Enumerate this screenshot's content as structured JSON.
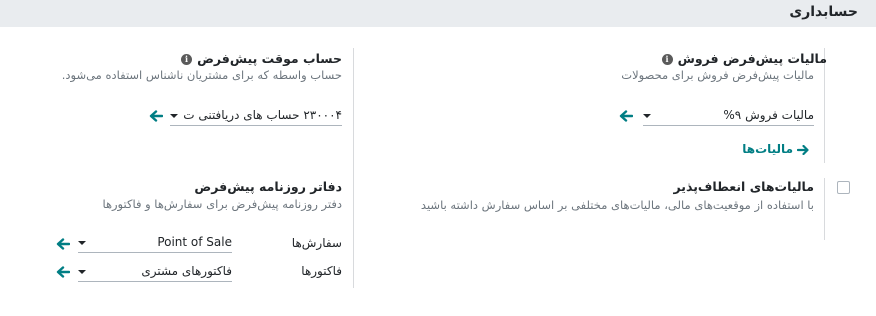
{
  "section": {
    "title": "حسابداری"
  },
  "default_taxes": {
    "title": "مالیات پیش‌فرض فروش",
    "description": "مالیات پیش‌فرض فروش برای محصولات",
    "sales_tax_value": "مالیات فروش ۹%",
    "taxes_link": "مالیات‌ها"
  },
  "default_temp_account": {
    "title": "حساب موقت پیش‌فرض",
    "description": "حساب واسطه که برای مشتریان ناشناس استفاده می‌شود.",
    "account_value": "۲۳۰۰۰۴ حساب های دریافتنی ت"
  },
  "flexible_taxes": {
    "title": "مالیات‌های انعطاف‌پذیر",
    "description": "با استفاده از موقعیت‌های مالی، مالیات‌های مختلفی بر اساس سفارش داشته باشید"
  },
  "default_journals": {
    "title": "دفاتر روزنامه پیش‌فرض",
    "description": "دفتر روزنامه پیش‌فرض برای سفارش‌ها و فاکتورها",
    "orders_label": "سفارش‌ها",
    "orders_value": "Point of Sale",
    "invoices_label": "فاکتورها",
    "invoices_value": "فاکتورهای مشتری"
  },
  "colors": {
    "accent": "#017e84",
    "header_bg": "#e9ecef"
  }
}
